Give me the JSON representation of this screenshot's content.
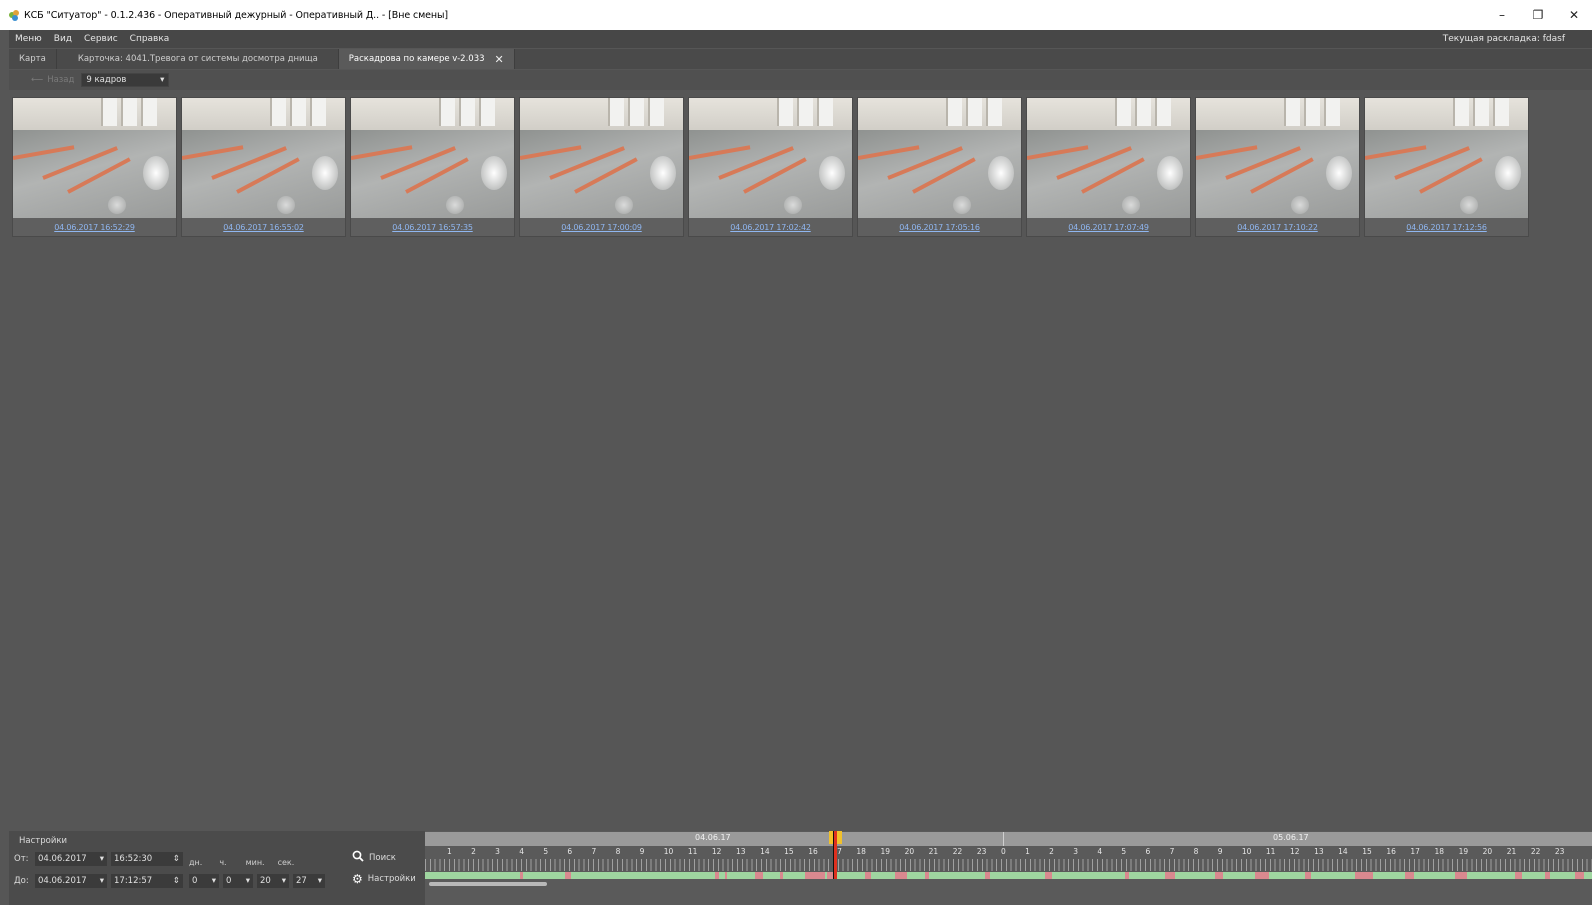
{
  "window": {
    "title": "КСБ \"Ситуатор\" - 0.1.2.436 - Оперативный дежурный - Оперативный Д.. - [Вне смены]",
    "controls": {
      "minimize": "–",
      "restore": "❐",
      "close": "✕"
    }
  },
  "menubar": {
    "items": [
      "Меню",
      "Вид",
      "Сервис",
      "Справка"
    ],
    "current_layout": "Текущая раскладка: fdasf"
  },
  "tabs": [
    {
      "label": "Карта",
      "active": false
    },
    {
      "label": "Карточка: 4041.Тревога от системы досмотра днища",
      "active": false
    },
    {
      "label": "Раскадрова по камере v-2.033",
      "active": true,
      "close": "✕"
    }
  ],
  "toolbar": {
    "back_label": "Назад",
    "back_arrow": "⟵",
    "frames_value": "9 кадров",
    "dropdown_arrow": "▾"
  },
  "frames": [
    "04.06.2017 16:52:29",
    "04.06.2017 16:55:02",
    "04.06.2017 16:57:35",
    "04.06.2017 17:00:09",
    "04.06.2017 17:02:42",
    "04.06.2017 17:05:16",
    "04.06.2017 17:07:49",
    "04.06.2017 17:10:22",
    "04.06.2017 17:12:56"
  ],
  "settings": {
    "title": "Настройки",
    "from_label": "От:",
    "to_label": "До:",
    "from_date": "04.06.2017",
    "from_time": "16:52:30",
    "to_date": "04.06.2017",
    "to_time": "17:12:57",
    "units": [
      "дн.",
      "ч.",
      "мин.",
      "сек."
    ],
    "interval_values": [
      "0",
      "0",
      "20",
      "27"
    ],
    "search_label": "Поиск",
    "settings_label": "Настройки",
    "search_icon": "search-icon",
    "gear_icon": "gear-icon"
  },
  "timeline": {
    "dates": [
      "04.06.17",
      "05.06.17"
    ],
    "day1_hours": [
      "1",
      "2",
      "3",
      "4",
      "5",
      "6",
      "7",
      "8",
      "9",
      "10",
      "11",
      "12",
      "13",
      "14",
      "15",
      "16",
      "17",
      "18",
      "19",
      "20",
      "21",
      "22",
      "23"
    ],
    "day2_hours": [
      "0",
      "1",
      "2",
      "3",
      "4",
      "5",
      "6",
      "7",
      "8",
      "9",
      "10",
      "11",
      "12",
      "13",
      "14",
      "15",
      "16",
      "17",
      "18",
      "19",
      "20",
      "21",
      "22",
      "23"
    ],
    "colors": {
      "recorded": "#9fd6a0",
      "alarm": "#d9898f",
      "cursor": "#e0301e",
      "cursor_cap": "#f1c12b"
    }
  }
}
